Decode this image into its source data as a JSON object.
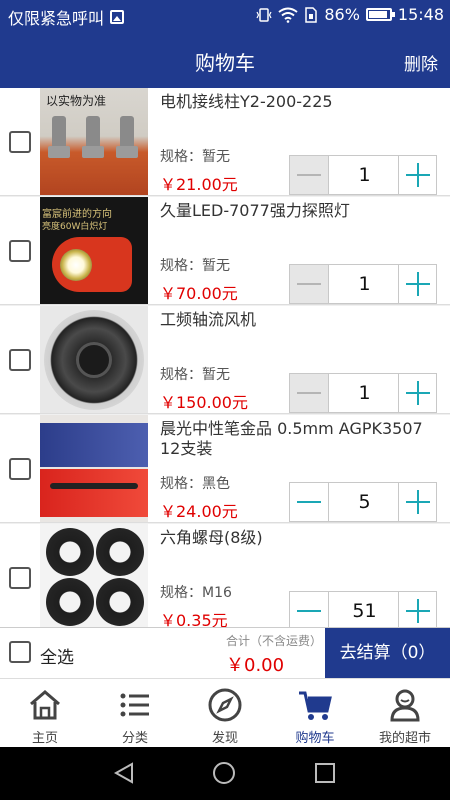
{
  "status_bar": {
    "carrier_text": "仅限紧急呼叫",
    "battery": "86%",
    "time": "15:48"
  },
  "header": {
    "title": "购物车",
    "delete_label": "删除"
  },
  "items": [
    {
      "name": "电机接线柱Y2-200-225",
      "spec": "规格：暂无",
      "price": "￥21.00元",
      "qty": "1",
      "image_caption": "以实物为准"
    },
    {
      "name": "久量LED-7077强力探照灯",
      "spec": "规格：暂无",
      "price": "￥70.00元",
      "qty": "1",
      "image_caption": "富宸前进的方向",
      "image_caption2": "亮度60W白炽灯"
    },
    {
      "name": "工频轴流风机",
      "spec": "规格：暂无",
      "price": "￥150.00元",
      "qty": "1"
    },
    {
      "name": "晨光中性笔金品 0.5mm AGPK3507 12支装",
      "spec": "规格：黑色",
      "price": "￥24.00元",
      "qty": "5"
    },
    {
      "name": "六角螺母(8级)",
      "spec": "规格：M16",
      "price": "￥0.35元",
      "qty": "51"
    }
  ],
  "checkout": {
    "select_all": "全选",
    "total_label": "合计（不含运费）",
    "total_value": "￥0.00",
    "settle_label": "去结算（0）"
  },
  "tabs": [
    {
      "label": "主页",
      "icon": "home-icon"
    },
    {
      "label": "分类",
      "icon": "list-icon"
    },
    {
      "label": "发现",
      "icon": "compass-icon"
    },
    {
      "label": "购物车",
      "icon": "cart-icon",
      "active": true
    },
    {
      "label": "我的超市",
      "icon": "user-icon"
    }
  ],
  "colors": {
    "brand": "#203a8e",
    "price": "#e00000",
    "stepper_accent": "#1aa7b5"
  }
}
